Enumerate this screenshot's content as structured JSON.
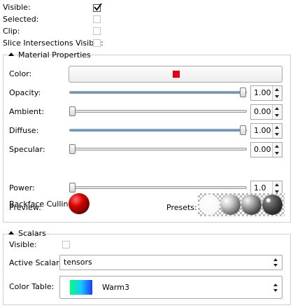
{
  "top": {
    "visible_label": "Visible:",
    "visible_checked": true,
    "selected_label": "Selected:",
    "selected_checked": false,
    "clip_label": "Clip:",
    "clip_checked": false,
    "slice_label": "Slice Intersections Visible:",
    "slice_checked": false
  },
  "material": {
    "title": "Material Properties",
    "color_label": "Color:",
    "color_value": "#e8000b",
    "opacity_label": "Opacity:",
    "opacity_value": "1.00",
    "opacity_level": 1.0,
    "ambient_label": "Ambient:",
    "ambient_value": "0.00",
    "ambient_level": 0.0,
    "diffuse_label": "Diffuse:",
    "diffuse_value": "1.00",
    "diffuse_level": 1.0,
    "specular_label": "Specular:",
    "specular_value": "0.00",
    "specular_level": 0.0,
    "power_label": "Power:",
    "power_value": "1.0",
    "power_level": 0.0,
    "backface_label": "Backface Culling:",
    "backface_checked": true,
    "preview_label": "Preview:",
    "presets_label": "Presets:"
  },
  "scalars": {
    "title": "Scalars",
    "visible_label": "Visible:",
    "visible_checked": false,
    "active_label": "Active Scalar:",
    "active_value": "tensors",
    "colortable_label": "Color Table:",
    "colortable_value": "Warm3"
  },
  "colors": {
    "slider_fill": "#3c87d0",
    "preview_red": "#c00000",
    "colortable_start": "#00ff7a",
    "colortable_end": "#1a3cff"
  }
}
